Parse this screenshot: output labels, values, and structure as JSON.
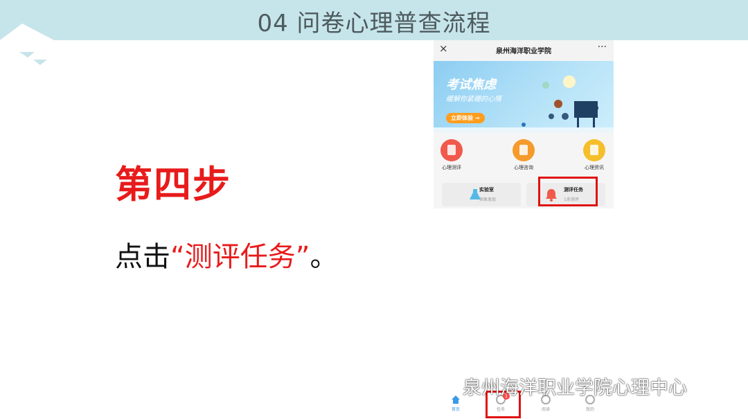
{
  "header": {
    "title": "04 问卷心理普查流程"
  },
  "step": {
    "title": "第四步",
    "instruction_prefix": "点击",
    "instruction_highlight": "“测评任务”",
    "instruction_suffix": "。"
  },
  "phone": {
    "app_title": "泉州海洋职业学院",
    "close_icon": "×",
    "more_icon": "···",
    "banner": {
      "title": "考试焦虑",
      "subtitle": "缓解你紧绷的心情",
      "button": "立即体验 →"
    },
    "quick_actions": [
      {
        "label": "心理测评",
        "color": "#f0594b"
      },
      {
        "label": "心理咨询",
        "color": "#f59a2b"
      },
      {
        "label": "心理资讯",
        "color": "#f5be2b"
      }
    ],
    "cards": [
      {
        "title": "实验室",
        "subtitle": "探索发现"
      },
      {
        "title": "测评任务",
        "subtitle": "1条测评"
      }
    ],
    "tabbar": [
      {
        "label": "首页",
        "active": true
      },
      {
        "label": "任务",
        "badge": "1"
      },
      {
        "label": "阅读"
      },
      {
        "label": "我的"
      }
    ]
  },
  "watermark": "泉州海洋职业学院心理中心",
  "colors": {
    "header_bg": "#c6e5ea",
    "accent_red": "#e81b1b"
  }
}
